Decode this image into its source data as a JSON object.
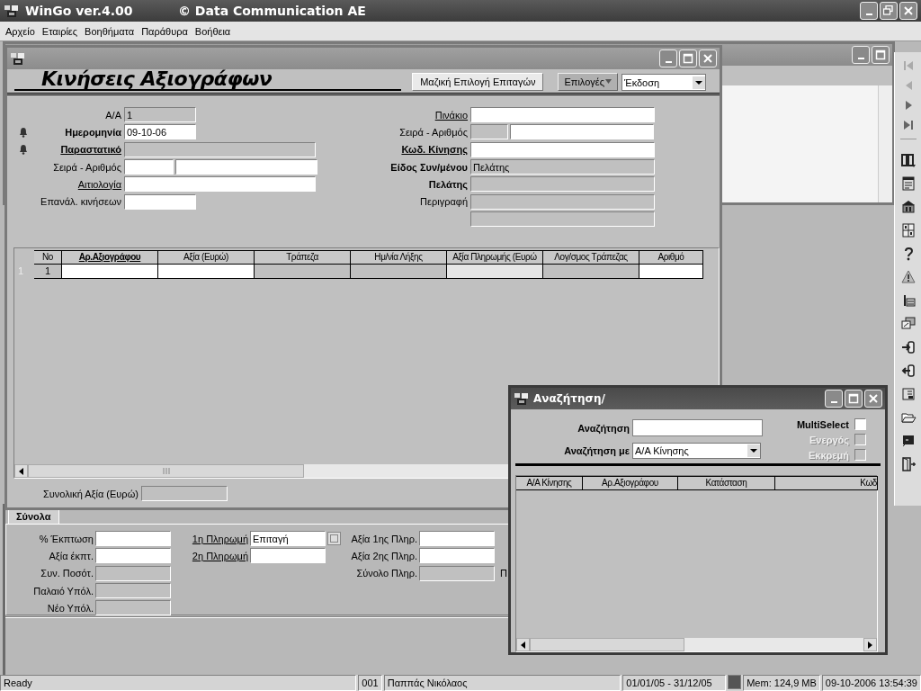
{
  "app": {
    "title": "WinGo ver.4.00",
    "subtitle": "© Data Communication AE"
  },
  "menu": [
    "Αρχείο",
    "Εταιρίες",
    "Βοηθήματα",
    "Παράθυρα",
    "Βοήθεια"
  ],
  "main": {
    "heading": "Κινήσεις Αξιογράφων",
    "mass_button": "Μαζική Επιλογή Επιταγών",
    "options_button": "Επιλογές",
    "print_select": "Έκδοση",
    "left_fields": [
      {
        "label": "Α/Α",
        "bold": false,
        "link": false,
        "alert": false,
        "kind": "short",
        "readonly": true,
        "value": "1"
      },
      {
        "label": "Ημερομηνία",
        "bold": true,
        "link": false,
        "alert": true,
        "kind": "short",
        "readonly": false,
        "value": "09-10-06"
      },
      {
        "label": "Παραστατικό",
        "bold": true,
        "link": true,
        "alert": true,
        "kind": "long",
        "readonly": true
      },
      {
        "label": "Σειρά - Αριθμός",
        "bold": false,
        "link": false,
        "alert": false,
        "kind": "pair",
        "parts": [
          {
            "readonly": false
          },
          {
            "readonly": false
          }
        ]
      },
      {
        "label": "Αιτιολογία",
        "bold": false,
        "link": true,
        "alert": false,
        "kind": "long",
        "readonly": false
      },
      {
        "label": "Επανάλ. κινήσεων",
        "bold": false,
        "link": false,
        "alert": false,
        "kind": "short",
        "readonly": false
      }
    ],
    "right_fields": [
      {
        "label": "Πινάκιο",
        "bold": false,
        "link": true,
        "kind": "long",
        "readonly": false
      },
      {
        "label": "Σειρά - Αριθμός",
        "bold": false,
        "link": false,
        "kind": "pair",
        "parts": [
          {
            "readonly": true
          },
          {
            "readonly": false
          }
        ]
      },
      {
        "label": "Κωδ. Κίνησης",
        "bold": true,
        "link": true,
        "kind": "long",
        "readonly": false
      },
      {
        "label": "Είδος Συν/μένου",
        "bold": true,
        "link": false,
        "kind": "long",
        "readonly": true,
        "value": "Πελάτης"
      },
      {
        "label": "Πελάτης",
        "bold": true,
        "link": false,
        "kind": "long",
        "readonly": true
      },
      {
        "label": "Περιγραφή",
        "bold": false,
        "link": false,
        "kind": "long",
        "readonly": true
      },
      {
        "kind": "long",
        "readonly": true
      }
    ],
    "grid": {
      "columns": [
        {
          "label": "No",
          "bold": false
        },
        {
          "label": "Αρ.Αξιογράφου",
          "bold": true
        },
        {
          "label": "Αξία (Ευρώ)",
          "bold": false
        },
        {
          "label": "Τράπεζα",
          "bold": false
        },
        {
          "label": "Ημ/νία Λήξης",
          "bold": false
        },
        {
          "label": "Αξία Πληρωμής (Ευρώ",
          "bold": false
        },
        {
          "label": "Λογ/σμος Τράπεζας",
          "bold": false
        },
        {
          "label": "Αριθμό",
          "bold": false
        }
      ],
      "rows": [
        {
          "indicator": "1",
          "cells": [
            {
              "kind": "number",
              "value": "1"
            },
            {
              "kind": "editable"
            },
            {
              "kind": "editable"
            },
            {
              "kind": "readonly"
            },
            {
              "kind": "readonly"
            },
            {
              "kind": "computed"
            },
            {
              "kind": "readonly"
            },
            {
              "kind": "editable"
            }
          ]
        }
      ]
    },
    "total": {
      "label": "Συνολική Αξία (Ευρώ)",
      "readonly": true
    }
  },
  "totals_panel": {
    "tabs": [
      {
        "label": "Σύνολα",
        "selected": true
      }
    ],
    "columns": [
      [
        {
          "label": "% Έκπτωση",
          "link": false,
          "readonly": false
        },
        {
          "label": "Αξία έκπτ.",
          "link": false,
          "readonly": false
        },
        {
          "label": "Συν. Ποσότ.",
          "link": false,
          "readonly": true
        },
        {
          "label": "Παλαιό Υπόλ.",
          "link": false,
          "readonly": true
        },
        {
          "label": "Νέο Υπόλ.",
          "link": false,
          "readonly": true
        }
      ],
      [
        {
          "label": "1η Πληρωμή",
          "link": true,
          "readonly": false,
          "value": "Επιταγή",
          "lookup": true
        },
        {
          "label": "2η Πληρωμή",
          "link": true,
          "readonly": false,
          "lookup": false
        }
      ],
      [
        {
          "label": "Αξία 1ης Πληρ.",
          "link": false,
          "readonly": false
        },
        {
          "label": "Αξία 2ης Πληρ.",
          "link": false,
          "readonly": false
        },
        {
          "label": "Σύνολο Πληρ.",
          "link": false,
          "readonly": true
        }
      ]
    ],
    "cut_label": "Π"
  },
  "search": {
    "title": "Αναζήτηση/",
    "search_label": "Αναζήτηση",
    "search_by_label": "Αναζήτηση με",
    "search_by_value": "Α/Α Κίνησης",
    "checks": [
      {
        "label": "MultiSelect",
        "checked": false,
        "disabled": false
      },
      {
        "label": "Ενεργός",
        "checked": false,
        "disabled": true
      },
      {
        "label": "Εκκρεμή",
        "checked": false,
        "disabled": true
      }
    ],
    "columns": [
      "Α/Α Κίνησης",
      "Αρ.Αξιογράφου",
      "Κατάσταση",
      "Κωδ"
    ]
  },
  "toolbar": {
    "nav": [
      {
        "kind": "first",
        "disabled": true
      },
      {
        "kind": "previous",
        "disabled": true
      },
      {
        "kind": "next",
        "disabled": false
      },
      {
        "kind": "last",
        "disabled": false
      }
    ]
  },
  "status_bar": [
    {
      "kind": "text",
      "text": "Ready"
    },
    {
      "kind": "text",
      "text": "001"
    },
    {
      "kind": "text",
      "text": "Παππάς Νικόλαος"
    },
    {
      "kind": "text",
      "text": "01/01/05 - 31/12/05"
    },
    {
      "kind": "indicator"
    },
    {
      "kind": "text",
      "text": "Mem: 124,9 MB"
    },
    {
      "kind": "text",
      "text": "09-10-2006 13:54:39"
    }
  ]
}
